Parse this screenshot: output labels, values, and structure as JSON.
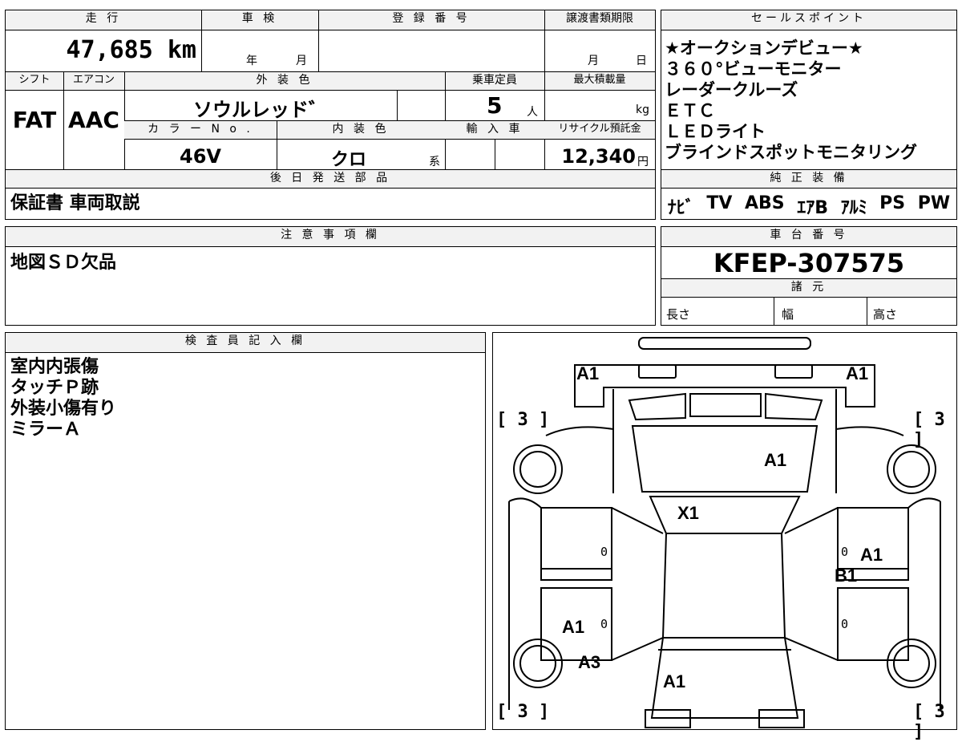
{
  "header": {
    "mileage_label": "走 行",
    "shaken_label": "車 検",
    "reg_no_label": "登 録 番 号",
    "transfer_label": "譲渡書類期限",
    "mileage_value": "47,685 km",
    "year_label": "年",
    "month_label": "月",
    "month2_label": "月",
    "day_label": "日",
    "shift_label": "シフト",
    "aircon_label": "エアコン",
    "ext_color_label": "外 装 色",
    "capacity_label": "乗車定員",
    "max_load_label": "最大積載量",
    "shift_value": "FAT",
    "aircon_value": "AAC",
    "ext_color_value": "ソウルレッド゛",
    "capacity_value": "5",
    "capacity_unit": "人",
    "load_unit": "kg",
    "color_no_label": "カ ラ ー N o .",
    "int_color_label": "内 装 色",
    "import_label": "輸 入 車",
    "recycle_label": "リサイクル預託金",
    "color_no_value": "46V",
    "int_color_value": "クロ",
    "int_color_suffix": "系",
    "recycle_value": "12,340",
    "recycle_unit": "円",
    "later_parts_label": "後 日 発 送 部 品",
    "later_parts_value": "保証書 車両取説"
  },
  "sales": {
    "label": "セールスポイント",
    "items": [
      "★オークションデビュー★",
      "３６０°ビューモニター",
      "レーダークルーズ",
      "ＥＴＣ",
      "ＬＥＤライト",
      "ブラインドスポットモニタリング"
    ]
  },
  "equipment": {
    "label": "純 正 装 備",
    "items": [
      "ﾅﾋﾞ",
      "TV",
      "ABS",
      "ｴｱB",
      "ｱﾙﾐ",
      "PS",
      "PW"
    ]
  },
  "caution": {
    "label": "注 意 事 項 欄",
    "value": "地図ＳＤ欠品"
  },
  "chassis": {
    "label": "車 台 番 号",
    "value": "KFEP-307575",
    "spec_label": "諸 元",
    "length_label": "長さ",
    "width_label": "幅",
    "height_label": "高さ"
  },
  "inspector": {
    "label": "検 査 員 記 入 欄",
    "lines": [
      "室内内張傷",
      "タッチＰ跡",
      "外装小傷有り",
      "ミラーＡ"
    ]
  },
  "diagram": {
    "marks": {
      "front_left": "A1",
      "front_right": "A1",
      "hood": "A1",
      "windshield": "X1",
      "right_door_a": "A1",
      "right_door_b": "B1",
      "rear_left_a": "A1",
      "rear_left_b": "A3",
      "trunk": "A1"
    },
    "tires": {
      "fl": "3",
      "fr": "3",
      "rl": "3",
      "rr": "3"
    },
    "zero": "0"
  }
}
